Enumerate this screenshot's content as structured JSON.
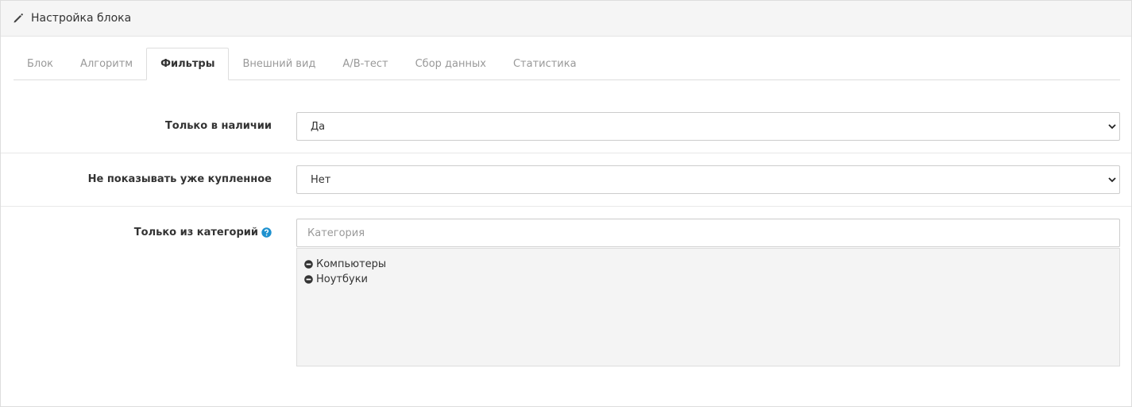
{
  "header": {
    "icon": "pencil-icon",
    "title": "Настройка блока"
  },
  "tabs": [
    {
      "label": "Блок",
      "active": false
    },
    {
      "label": "Алгоритм",
      "active": false
    },
    {
      "label": "Фильтры",
      "active": true
    },
    {
      "label": "Внешний вид",
      "active": false
    },
    {
      "label": "A/B-тест",
      "active": false
    },
    {
      "label": "Сбор данных",
      "active": false
    },
    {
      "label": "Статистика",
      "active": false
    }
  ],
  "filters": {
    "in_stock": {
      "label": "Только в наличии",
      "value": "Да"
    },
    "hide_purchased": {
      "label": "Не показывать уже купленное",
      "value": "Нет"
    },
    "categories": {
      "label": "Только из категорий",
      "help_icon": "question-circle-icon",
      "placeholder": "Категория",
      "items": [
        {
          "label": "Компьютеры",
          "icon": "minus-circle-icon"
        },
        {
          "label": "Ноутбуки",
          "icon": "minus-circle-icon"
        }
      ]
    }
  },
  "colors": {
    "help_icon": "#1e91cf",
    "remove_icon": "#333333"
  }
}
